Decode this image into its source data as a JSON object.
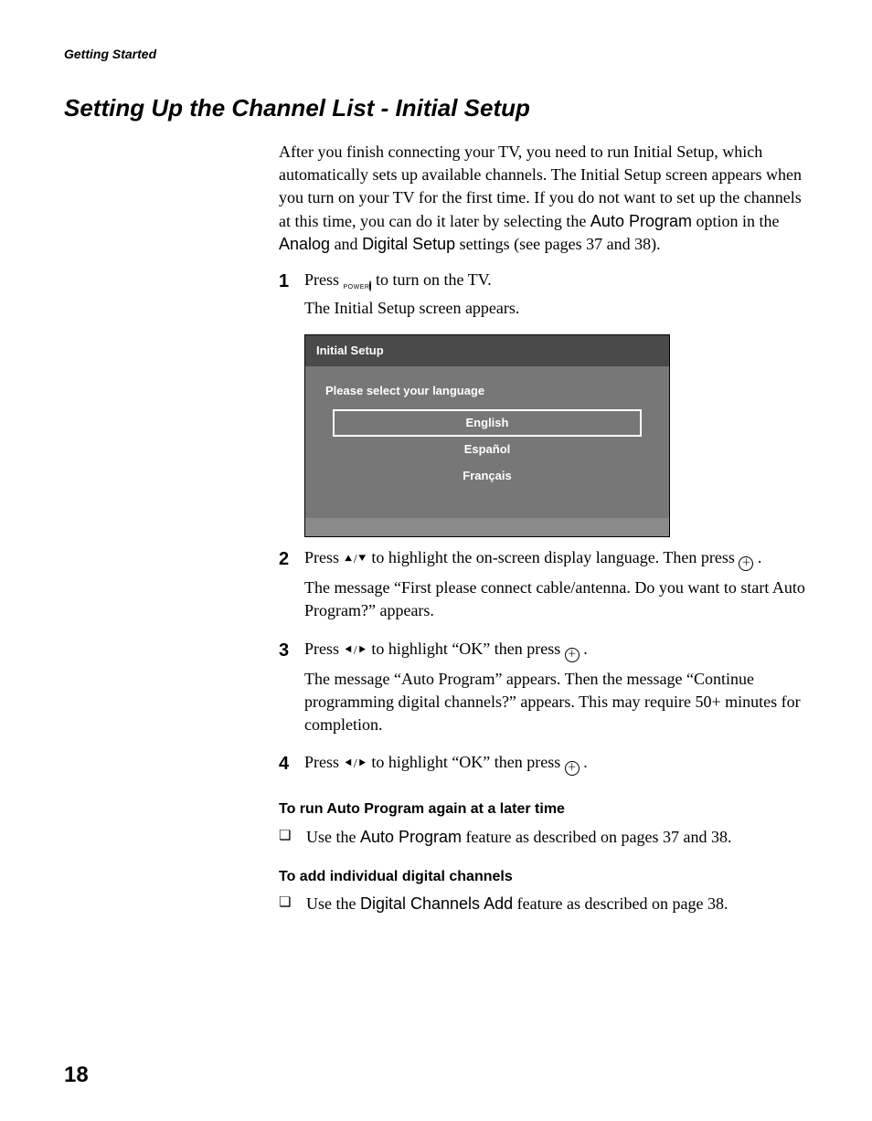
{
  "runningHead": "Getting Started",
  "pageTitle": "Setting Up the Channel List - Initial Setup",
  "intro": {
    "part1": "After you finish connecting your TV, you need to run Initial Setup, which automatically sets up available channels. The Initial Setup screen appears when you turn on your TV for the first time. If you do not want to set up the channels at this time, you can do it later by selecting the ",
    "autoProgram": "Auto Program",
    "part2": " option in the ",
    "analog": "Analog",
    "part3": " and ",
    "digitalSetup": "Digital Setup",
    "part4": " settings (see pages 37 and 38)."
  },
  "steps": {
    "s1": {
      "num": "1",
      "line1a": "Press ",
      "powerLabel": "POWER",
      "line1b": " to turn on the TV.",
      "line2": "The Initial Setup screen appears."
    },
    "s2": {
      "num": "2",
      "line1a": "Press ",
      "line1b": " to highlight the on-screen display language. Then press ",
      "line1c": " .",
      "line2": "The message “First please connect cable/antenna. Do you want to start Auto Program?” appears."
    },
    "s3": {
      "num": "3",
      "line1a": "Press ",
      "line1b": " to highlight “OK” then press ",
      "line1c": " .",
      "line2": "The message “Auto Program” appears.  Then the message “Continue programming digital channels?” appears. This may require 50+ minutes for completion."
    },
    "s4": {
      "num": "4",
      "line1a": "Press ",
      "line1b": " to highlight “OK” then press ",
      "line1c": " ."
    }
  },
  "tvScreen": {
    "title": "Initial Setup",
    "prompt": "Please select your language",
    "options": [
      "English",
      "Español",
      "Français"
    ]
  },
  "subA": {
    "head": "To run Auto Program again at a later time",
    "textA": "Use the ",
    "feature": "Auto Program",
    "textB": " feature as described on pages 37 and 38."
  },
  "subB": {
    "head": "To add individual digital channels",
    "textA": "Use the ",
    "feature": "Digital Channels Add",
    "textB": " feature as described on page 38."
  },
  "arrows": {
    "up": "⯅",
    "down": "⯆",
    "left": "⯇",
    "right": "⯈",
    "sep": "/"
  },
  "selectGlyph": "＋",
  "pageNumber": "18"
}
